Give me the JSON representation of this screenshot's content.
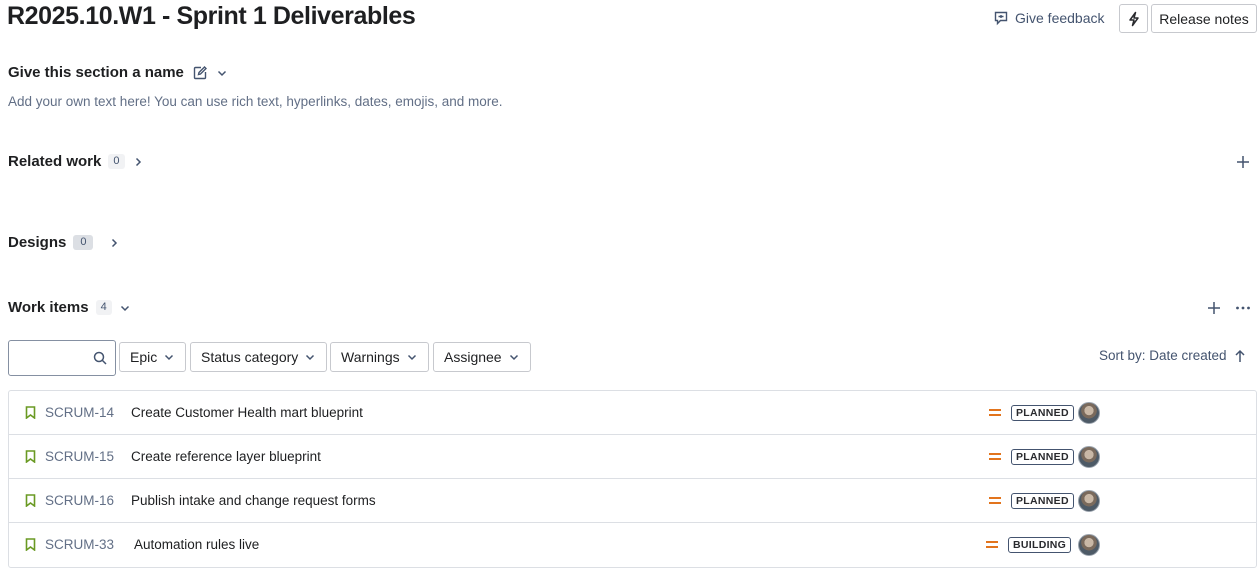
{
  "header": {
    "title": "R2025.10.W1 - Sprint 1 Deliverables",
    "feedback_label": "Give feedback",
    "release_notes_label": "Release notes"
  },
  "section": {
    "name": "Give this section a name",
    "description": "Add your own text here! You can use rich text, hyperlinks, dates, emojis, and more."
  },
  "related_work": {
    "label": "Related work",
    "count": "0"
  },
  "designs": {
    "label": "Designs",
    "count": "0"
  },
  "work_items": {
    "label": "Work items",
    "count": "4",
    "search_placeholder": "",
    "filters": [
      "Epic",
      "Status category",
      "Warnings",
      "Assignee"
    ],
    "sort_label": "Sort by: Date created",
    "rows": [
      {
        "key": "SCRUM-14",
        "summary": "Create Customer Health mart blueprint",
        "status": "PLANNED"
      },
      {
        "key": "SCRUM-15",
        "summary": "Create reference layer blueprint",
        "status": "PLANNED"
      },
      {
        "key": "SCRUM-16",
        "summary": "Publish intake and change request forms",
        "status": "PLANNED"
      },
      {
        "key": "SCRUM-33",
        "summary": "Automation rules live",
        "status": "BUILDING"
      }
    ]
  },
  "colors": {
    "story_icon": "#6a9a23",
    "priority_medium": "#e2741d",
    "text_primary": "#1e1f21",
    "text_subtle": "#626f86",
    "border": "#dcdfe4"
  },
  "icons": {
    "feedback": "feedback-icon",
    "bolt": "lightning-icon",
    "edit": "edit-icon",
    "chevron_down": "chevron-down-icon",
    "chevron_right": "chevron-right-icon",
    "add": "plus-icon",
    "more": "more-icon",
    "search": "search-icon",
    "sort": "arrow-up-icon",
    "story": "bookmark-icon",
    "priority": "priority-medium-icon"
  }
}
